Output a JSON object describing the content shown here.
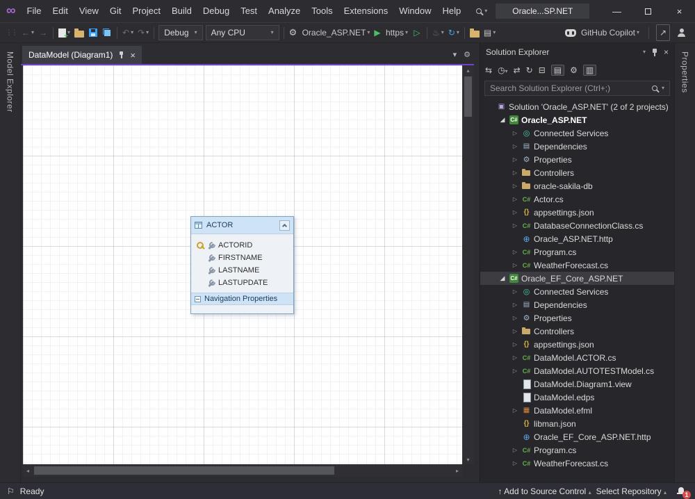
{
  "titlebar": {
    "app_menu": [
      "File",
      "Edit",
      "View",
      "Git",
      "Project",
      "Build",
      "Debug",
      "Test",
      "Analyze",
      "Tools",
      "Extensions",
      "Window",
      "Help"
    ],
    "window_title": "Oracle...SP.NET"
  },
  "toolbar": {
    "config_dropdown": "Debug",
    "platform_dropdown": "Any CPU",
    "startup_project": "Oracle_ASP.NET",
    "run_profile": "https",
    "copilot_label": "GitHub Copilot"
  },
  "left_rail": {
    "label": "Model Explorer"
  },
  "right_rail": {
    "label": "Properties"
  },
  "editor": {
    "tab_label": "DataModel (Diagram1)",
    "entity": {
      "title": "ACTOR",
      "properties": [
        {
          "name": "ACTORID",
          "is_key": true
        },
        {
          "name": "FIRSTNAME",
          "is_key": false
        },
        {
          "name": "LASTNAME",
          "is_key": false
        },
        {
          "name": "LASTUPDATE",
          "is_key": false
        }
      ],
      "nav_section": "Navigation Properties"
    }
  },
  "solution_explorer": {
    "title": "Solution Explorer",
    "search_placeholder": "Search Solution Explorer (Ctrl+;)",
    "tree": [
      {
        "label": "Solution 'Oracle_ASP.NET' (2 of 2 projects)",
        "level": 0,
        "expand": "none",
        "icon": "solution"
      },
      {
        "label": "Oracle_ASP.NET",
        "level": 1,
        "expand": "open",
        "icon": "csproj",
        "bold": true
      },
      {
        "label": "Connected Services",
        "level": 2,
        "expand": "closed",
        "icon": "connected-services"
      },
      {
        "label": "Dependencies",
        "level": 2,
        "expand": "closed",
        "icon": "dependencies"
      },
      {
        "label": "Properties",
        "level": 2,
        "expand": "closed",
        "icon": "properties"
      },
      {
        "label": "Controllers",
        "level": 2,
        "expand": "closed",
        "icon": "folder"
      },
      {
        "label": "oracle-sakila-db",
        "level": 2,
        "expand": "closed",
        "icon": "folder"
      },
      {
        "label": "Actor.cs",
        "level": 2,
        "expand": "closed",
        "icon": "csharp"
      },
      {
        "label": "appsettings.json",
        "level": 2,
        "expand": "closed",
        "icon": "json"
      },
      {
        "label": "DatabaseConnectionClass.cs",
        "level": 2,
        "expand": "closed",
        "icon": "csharp"
      },
      {
        "label": "Oracle_ASP.NET.http",
        "level": 2,
        "expand": "none",
        "icon": "http"
      },
      {
        "label": "Program.cs",
        "level": 2,
        "expand": "closed",
        "icon": "csharp"
      },
      {
        "label": "WeatherForecast.cs",
        "level": 2,
        "expand": "closed",
        "icon": "csharp"
      },
      {
        "label": "Oracle_EF_Core_ASP.NET",
        "level": 1,
        "expand": "open",
        "icon": "csproj",
        "selected": true
      },
      {
        "label": "Connected Services",
        "level": 2,
        "expand": "closed",
        "icon": "connected-services"
      },
      {
        "label": "Dependencies",
        "level": 2,
        "expand": "closed",
        "icon": "dependencies"
      },
      {
        "label": "Properties",
        "level": 2,
        "expand": "closed",
        "icon": "properties"
      },
      {
        "label": "Controllers",
        "level": 2,
        "expand": "closed",
        "icon": "folder"
      },
      {
        "label": "appsettings.json",
        "level": 2,
        "expand": "closed",
        "icon": "json"
      },
      {
        "label": "DataModel.ACTOR.cs",
        "level": 2,
        "expand": "closed",
        "icon": "csharp"
      },
      {
        "label": "DataModel.AUTOTESTModel.cs",
        "level": 2,
        "expand": "closed",
        "icon": "csharp"
      },
      {
        "label": "DataModel.Diagram1.view",
        "level": 2,
        "expand": "none",
        "icon": "file"
      },
      {
        "label": "DataModel.edps",
        "level": 2,
        "expand": "none",
        "icon": "file"
      },
      {
        "label": "DataModel.efml",
        "level": 2,
        "expand": "closed",
        "icon": "efml"
      },
      {
        "label": "libman.json",
        "level": 2,
        "expand": "none",
        "icon": "json"
      },
      {
        "label": "Oracle_EF_Core_ASP.NET.http",
        "level": 2,
        "expand": "none",
        "icon": "http"
      },
      {
        "label": "Program.cs",
        "level": 2,
        "expand": "closed",
        "icon": "csharp"
      },
      {
        "label": "WeatherForecast.cs",
        "level": 2,
        "expand": "closed",
        "icon": "csharp"
      }
    ]
  },
  "statusbar": {
    "ready_label": "Ready",
    "source_control_label": "Add to Source Control",
    "repository_label": "Select Repository",
    "notification_count": "1"
  },
  "colors": {
    "accent_purple": "#7442c8",
    "run_green": "#4cc05e",
    "save_blue": "#3aa0f3",
    "entity_header_blue": "#cfe3f6",
    "selection_gray": "#3c3c42",
    "badge_red": "#d84b4b"
  }
}
